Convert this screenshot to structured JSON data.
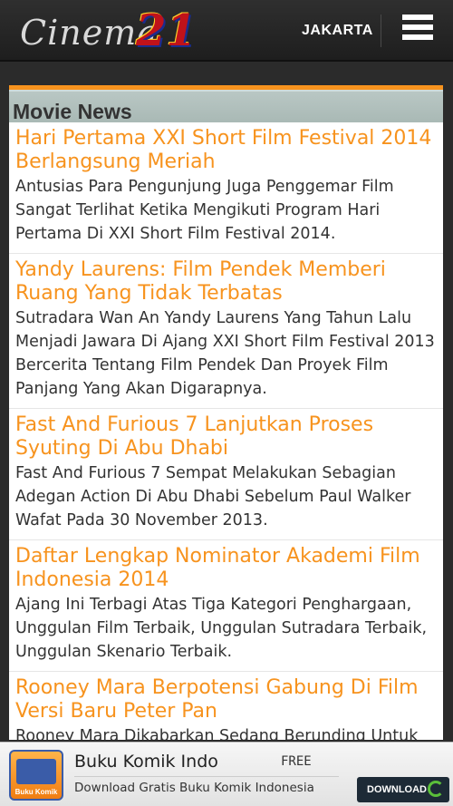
{
  "header": {
    "logo_text": "Cinema",
    "logo_number": "21",
    "city": "JAKARTA"
  },
  "section": {
    "title": "Movie News"
  },
  "news": [
    {
      "title": "Hari Pertama XXI Short Film Festival 2014 Berlangsung Meriah",
      "desc": "Antusias Para Pengunjung Juga Penggemar Film Sangat Terlihat Ketika Mengikuti Program Hari Pertama Di XXI Short Film Festival 2014."
    },
    {
      "title": "Yandy Laurens: Film Pendek Memberi Ruang Yang Tidak Terbatas",
      "desc": "Sutradara Wan An Yandy Laurens Yang Tahun Lalu Menjadi Jawara Di Ajang XXI Short Film Festival 2013 Bercerita Tentang Film Pendek Dan Proyek Film Panjang Yang Akan Digarapnya."
    },
    {
      "title": "Fast And Furious 7 Lanjutkan Proses Syuting Di Abu Dhabi",
      "desc": "Fast And Furious 7 Sempat Melakukan Sebagian Adegan Action Di Abu Dhabi Sebelum Paul Walker Wafat Pada 30 November 2013."
    },
    {
      "title": "Daftar Lengkap Nominator Akademi Film Indonesia 2014",
      "desc": "Ajang Ini Terbagi Atas Tiga Kategori Penghargaan, Unggulan Film Terbaik, Unggulan Sutradara Terbaik, Unggulan Skenario Terbaik."
    },
    {
      "title": "Rooney Mara Berpotensi Gabung Di Film Versi Baru Peter Pan",
      "desc": "Rooney Mara Dikabarkan Sedang Berunding Untuk Memerankan Tiger Lily Di Film Pan."
    }
  ],
  "ad": {
    "icon_label": "Buku Komik",
    "title": "Buku Komik Indo",
    "free_label": "FREE",
    "subtitle": "Download Gratis Buku Komik Indonesia",
    "button_label": "DOWNLOAD"
  },
  "colors": {
    "accent": "#f7931e",
    "header_bg": "#2b2b2b",
    "section_bg": "#b9c7c4"
  }
}
